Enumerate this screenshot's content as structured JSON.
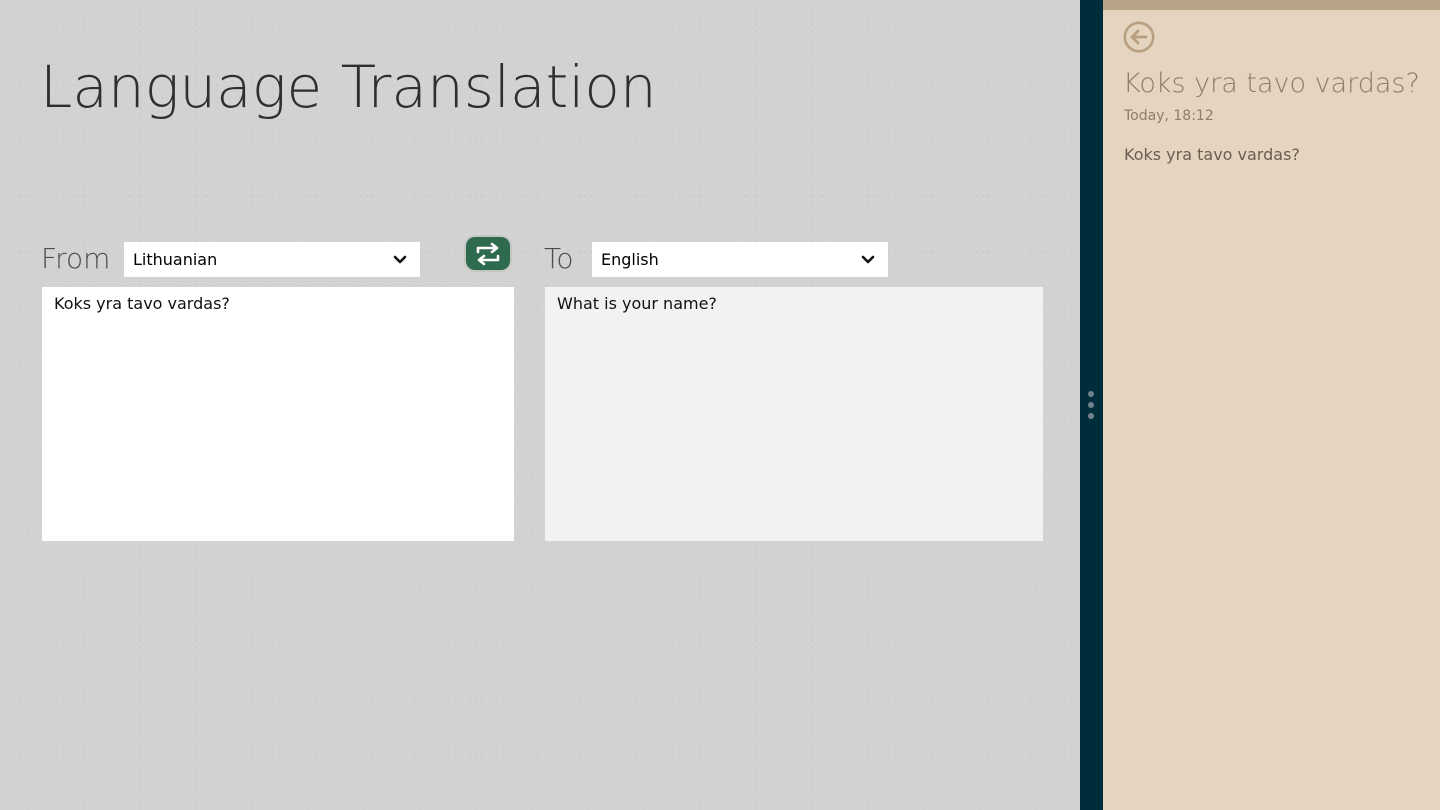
{
  "app": {
    "title": "Language Translation"
  },
  "translator": {
    "from_label": "From",
    "to_label": "To",
    "from_language": "Lithuanian",
    "to_language": "English",
    "source_text": "Koks yra tavo vardas?",
    "translated_text": "What is your name?"
  },
  "side_panel": {
    "title": "Koks yra tavo vardas?",
    "timestamp": "Today, 18:12",
    "body": "Koks yra tavo vardas?"
  },
  "icons": {
    "swap": "swap-languages-icon",
    "chevron": "chevron-down-icon",
    "back": "back-arrow-icon",
    "resize": "resize-grip-icon"
  },
  "colors": {
    "main_background": "#d2d2d2",
    "swap_button": "#2e6a4e",
    "divider": "#002d3b",
    "side_panel": "#e5d4bf",
    "side_text": "#8c7c67"
  }
}
